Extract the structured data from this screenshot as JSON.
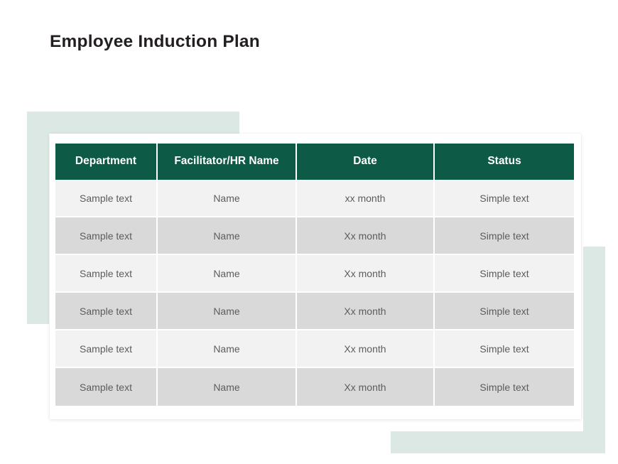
{
  "slide": {
    "title": "Employee Induction Plan",
    "background_color": "#ffffff"
  },
  "decor": {
    "bracket_color": "#dce8e4",
    "brackets": [
      {
        "name": "top-left-corner-bracket"
      },
      {
        "name": "bottom-right-corner-bracket"
      }
    ]
  },
  "table": {
    "header_bg": "#0d5a47",
    "header_text_color": "#ffffff",
    "row_light_bg": "#f2f2f2",
    "row_dark_bg": "#d9d9d9",
    "cell_text_color": "#5c5c5c",
    "columns": [
      {
        "key": "department",
        "label": "Department"
      },
      {
        "key": "facilitator",
        "label": "Facilitator/HR Name"
      },
      {
        "key": "date",
        "label": "Date"
      },
      {
        "key": "status",
        "label": "Status"
      }
    ],
    "rows": [
      {
        "department": "Sample text",
        "facilitator": "Name",
        "date": "xx month",
        "status": "Simple text"
      },
      {
        "department": "Sample text",
        "facilitator": "Name",
        "date": "Xx month",
        "status": "Simple text"
      },
      {
        "department": "Sample text",
        "facilitator": "Name",
        "date": "Xx month",
        "status": "Simple text"
      },
      {
        "department": "Sample text",
        "facilitator": "Name",
        "date": "Xx month",
        "status": "Simple text"
      },
      {
        "department": "Sample text",
        "facilitator": "Name",
        "date": "Xx month",
        "status": "Simple text"
      },
      {
        "department": "Sample text",
        "facilitator": "Name",
        "date": "Xx month",
        "status": "Simple text"
      }
    ]
  }
}
